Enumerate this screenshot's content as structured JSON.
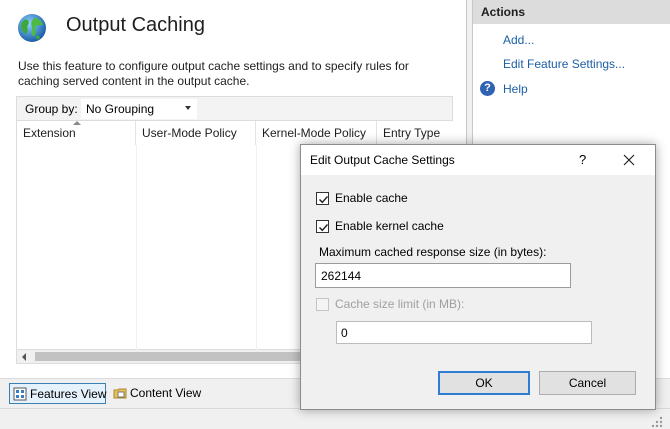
{
  "feature": {
    "title": "Output Caching",
    "description": "Use this feature to configure output cache settings and to specify rules for caching served content in the output cache.",
    "group_by_label": "Group by:",
    "group_by_value": "No Grouping",
    "columns": [
      "Extension",
      "User-Mode Policy",
      "Kernel-Mode Policy",
      "Entry Type"
    ]
  },
  "view_tabs": {
    "features_view": "Features View",
    "content_view": "Content View"
  },
  "actions": {
    "title": "Actions",
    "add": "Add...",
    "edit_feature_settings": "Edit Feature Settings...",
    "help": "Help"
  },
  "dialog": {
    "title": "Edit Output Cache Settings",
    "help_glyph": "?",
    "enable_cache_label": "Enable cache",
    "enable_cache_checked": true,
    "enable_kernel_cache_label": "Enable kernel cache",
    "enable_kernel_cache_checked": true,
    "max_response_size_label": "Maximum cached response size (in bytes):",
    "max_response_size_value": "262144",
    "cache_size_limit_label": "Cache size limit (in MB):",
    "cache_size_limit_checked": false,
    "cache_size_limit_value": "0",
    "ok_label": "OK",
    "cancel_label": "Cancel"
  },
  "colors": {
    "link": "#1d5fa5",
    "accent": "#2f7cd4",
    "actions_header": "#dcdcdc"
  }
}
